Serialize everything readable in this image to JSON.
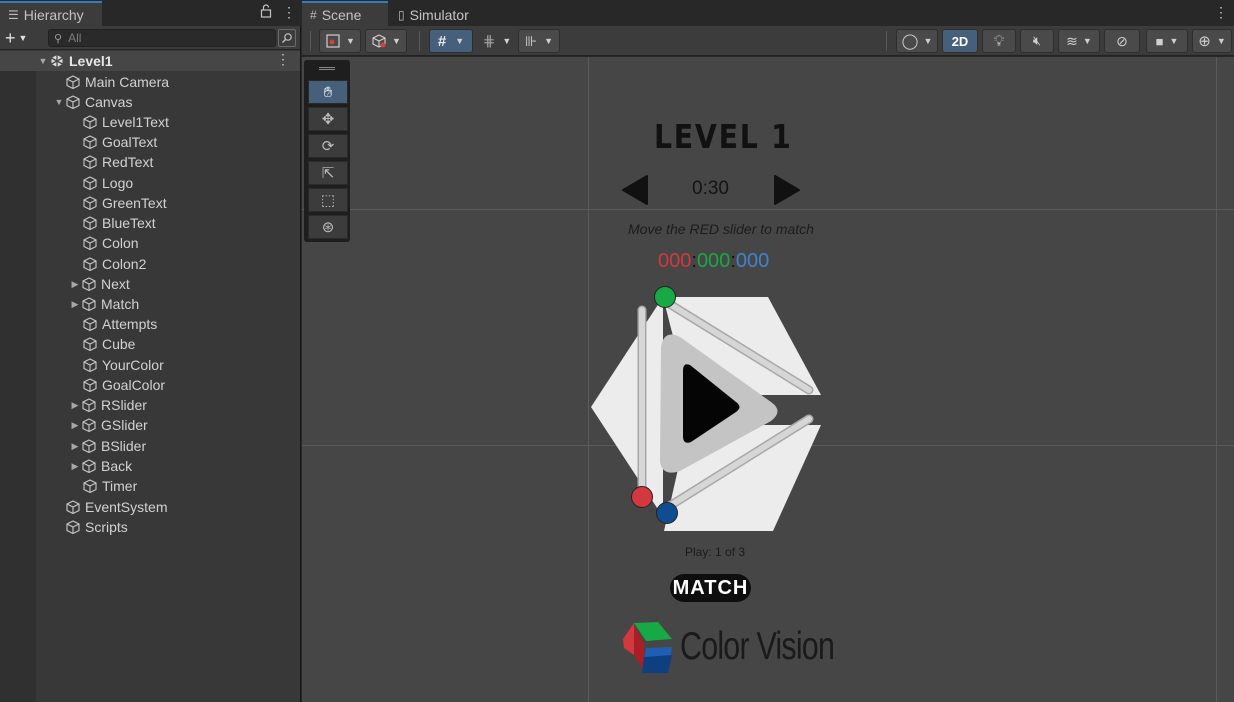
{
  "hierarchy": {
    "tab_label": "Hierarchy",
    "search_placeholder": "All",
    "scene_name": "Level1",
    "items": {
      "main_camera": "Main Camera",
      "canvas": "Canvas",
      "level1text": "Level1Text",
      "goaltext": "GoalText",
      "redtext": "RedText",
      "logo": "Logo",
      "greentext": "GreenText",
      "bluetext": "BlueText",
      "colon": "Colon",
      "colon2": "Colon2",
      "next": "Next",
      "match": "Match",
      "attempts": "Attempts",
      "cube": "Cube",
      "yourcolor": "YourColor",
      "goalcolor": "GoalColor",
      "rslider": "RSlider",
      "gslider": "GSlider",
      "bslider": "BSlider",
      "back": "Back",
      "timer": "Timer",
      "eventsystem": "EventSystem",
      "scripts": "Scripts"
    }
  },
  "scene": {
    "tab_scene": "Scene",
    "tab_simulator": "Simulator",
    "toggle_2d": "2D"
  },
  "game": {
    "level_title": "LEVEL 1",
    "timer": "0:30",
    "goal_text": "Move the RED slider to match",
    "red_value": "000",
    "green_value": "000",
    "blue_value": "000",
    "separator": ":",
    "play_count": "Play: 1 of 3",
    "match_label": "MATCH",
    "brand_name": "Color Vision"
  },
  "colors": {
    "red": "#d2383e",
    "green": "#17a944",
    "blue": "#3f83d0",
    "accent": "#46607c"
  }
}
